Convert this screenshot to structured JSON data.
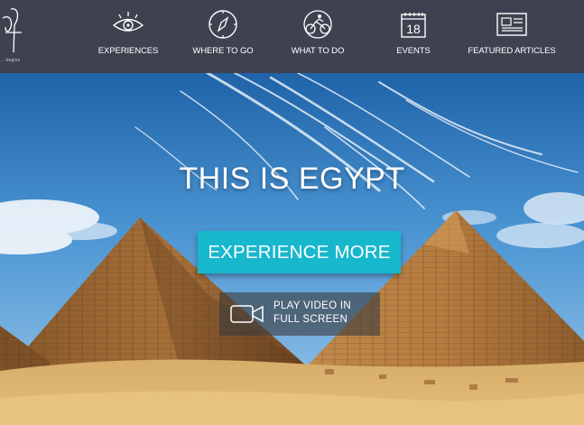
{
  "logo": {
    "tagline": "... begins"
  },
  "nav": {
    "items": [
      {
        "label": "EXPERIENCES",
        "icon": "eye-icon"
      },
      {
        "label": "WHERE TO GO",
        "icon": "compass-icon"
      },
      {
        "label": "WHAT TO DO",
        "icon": "cyclist-icon"
      },
      {
        "label": "EVENTS",
        "icon": "calendar-icon",
        "icon_text": "18"
      },
      {
        "label": "FEATURED ARTICLES",
        "icon": "newspaper-icon"
      }
    ]
  },
  "hero": {
    "title": "THIS IS EGYPT",
    "cta_label": "EXPERIENCE MORE",
    "video_line1": "PLAY VIDEO IN",
    "video_line2": "FULL SCREEN",
    "video_icon": "video-camera-icon"
  },
  "colors": {
    "nav_bg": "#3f4150",
    "cta": "#17b7cc",
    "sky": "#3a86c9",
    "sand": "#d9a85b"
  }
}
